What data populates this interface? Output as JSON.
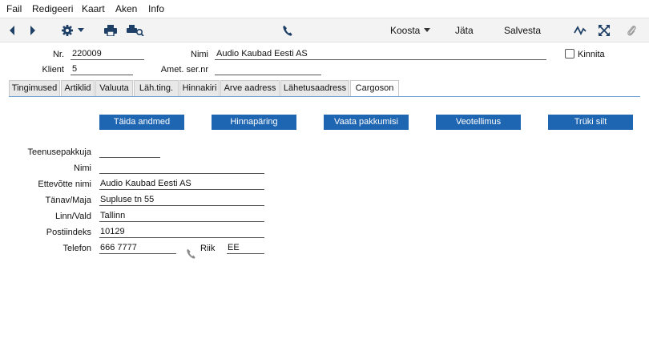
{
  "menu": {
    "items": [
      "Fail",
      "Redigeeri",
      "Kaart",
      "Aken",
      "Info"
    ]
  },
  "toolbar": {
    "compose_label": "Koosta",
    "discard_label": "Jäta",
    "save_label": "Salvesta"
  },
  "header": {
    "nr_label": "Nr.",
    "nr_value": "220009",
    "name_label": "Nimi",
    "name_value": "Audio Kaubad Eesti AS",
    "confirm_label": "Kinnita",
    "client_label": "Klient",
    "client_value": "5",
    "serial_label": "Amet. ser.nr",
    "serial_value": ""
  },
  "tabs": [
    "Tingimused",
    "Artiklid",
    "Valuuta",
    "Läh.ting.",
    "Hinnakiri",
    "Arve aadress",
    "Lähetusaadress",
    "Cargoson"
  ],
  "active_tab": "Cargoson",
  "actions": {
    "fill_label": "Täida andmed",
    "price_query_label": "Hinnapäring",
    "view_packages_label": "Vaata pakkumisi",
    "order_transport_label": "Veotellimus",
    "print_label_label": "Trüki silt"
  },
  "form": {
    "provider_label": "Teenusepakkuja",
    "provider_value": "",
    "name_label": "Nimi",
    "name_value": "",
    "company_label": "Ettevõtte nimi",
    "company_value": "Audio Kaubad Eesti AS",
    "street_label": "Tänav/Maja",
    "street_value": "Supluse tn 55",
    "city_label": "Linn/Vald",
    "city_value": "Tallinn",
    "postal_label": "Postiindeks",
    "postal_value": "10129",
    "phone_label": "Telefon",
    "phone_value": "666 7777",
    "country_label": "Riik",
    "country_value": "EE"
  },
  "icons": {
    "prev": "chevron-left-icon",
    "next": "chevron-right-icon",
    "settings": "gear-icon",
    "print": "printer-icon",
    "print_preview": "print-preview-icon",
    "phone": "phone-icon",
    "activity": "activity-icon",
    "expand": "expand-icon",
    "attach": "paperclip-icon"
  },
  "colors": {
    "accent": "#1f66b2",
    "toolbar_bg": "#f3f3f3",
    "tab_bg": "#e8e8e8"
  }
}
